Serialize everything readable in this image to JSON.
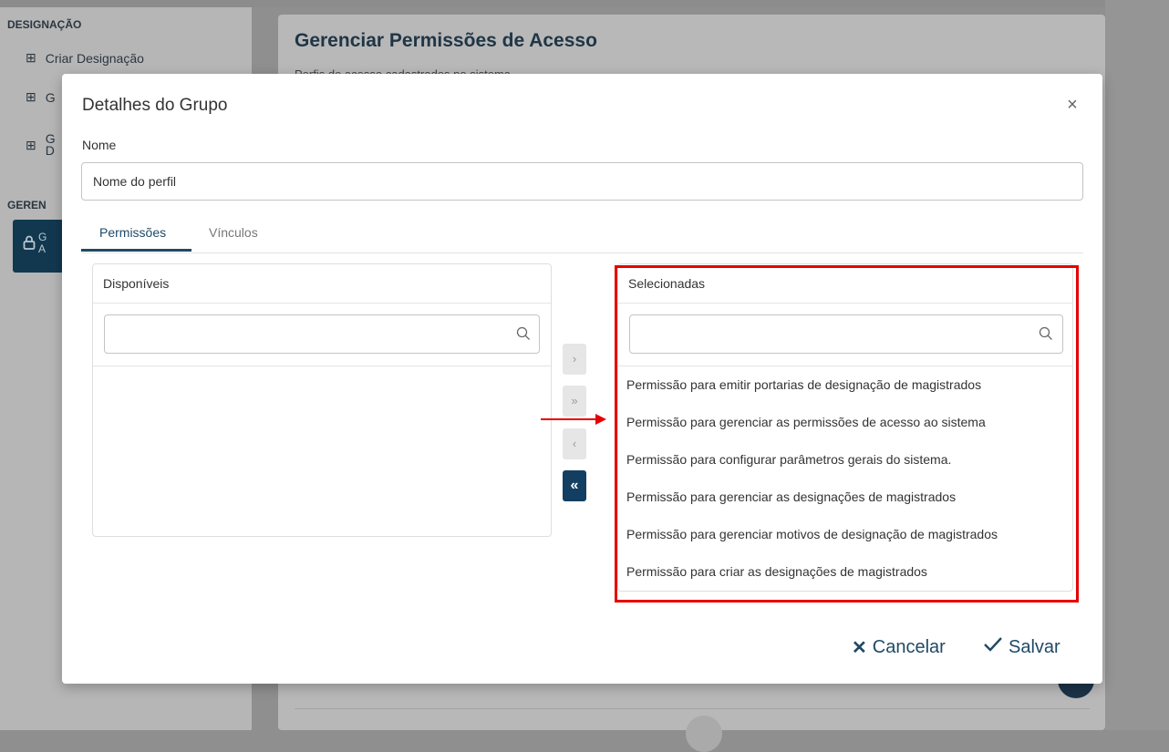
{
  "sidebar": {
    "section_designacao": "DESIGNAÇÃO",
    "items": [
      {
        "label": "Criar Designação",
        "icon": "grid-icon"
      },
      {
        "label": "G",
        "icon": "grid-icon"
      },
      {
        "label": "G\nD",
        "icon": "grid-icon"
      }
    ],
    "section_gerenciamento": "GEREN",
    "active_item": {
      "label": "G\nA",
      "icon": "lock-icon"
    }
  },
  "main": {
    "title": "Gerenciar Permissões de Acesso",
    "subtitle": "Perfis de acesso cadastrados no sistema"
  },
  "modal": {
    "title": "Detalhes do Grupo",
    "name_label": "Nome",
    "name_value": "Nome do perfil",
    "tabs": [
      {
        "label": "Permissões",
        "active": true
      },
      {
        "label": "Vínculos",
        "active": false
      }
    ],
    "available": {
      "header": "Disponíveis",
      "filter_value": "",
      "items": []
    },
    "selected": {
      "header": "Selecionadas",
      "filter_value": "",
      "items": [
        "Permissão para emitir portarias de designação de magistrados",
        "Permissão para gerenciar as permissões de acesso ao sistema",
        "Permissão para configurar parâmetros gerais do sistema.",
        "Permissão para gerenciar as designações de magistrados",
        "Permissão para gerenciar motivos de designação de magistrados",
        "Permissão para criar as designações de magistrados"
      ]
    },
    "transfer_buttons": [
      {
        "symbol": "›",
        "name": "move-right-button",
        "enabled": false
      },
      {
        "symbol": "»",
        "name": "move-all-right-button",
        "enabled": false
      },
      {
        "symbol": "‹",
        "name": "move-left-button",
        "enabled": false
      },
      {
        "symbol": "«",
        "name": "move-all-left-button",
        "enabled": true
      }
    ],
    "cancel_label": "Cancelar",
    "save_label": "Salvar",
    "close_symbol": "×"
  },
  "colors": {
    "accent": "#1f4a66",
    "primary_button": "#123f61",
    "highlight": "#e60000"
  }
}
